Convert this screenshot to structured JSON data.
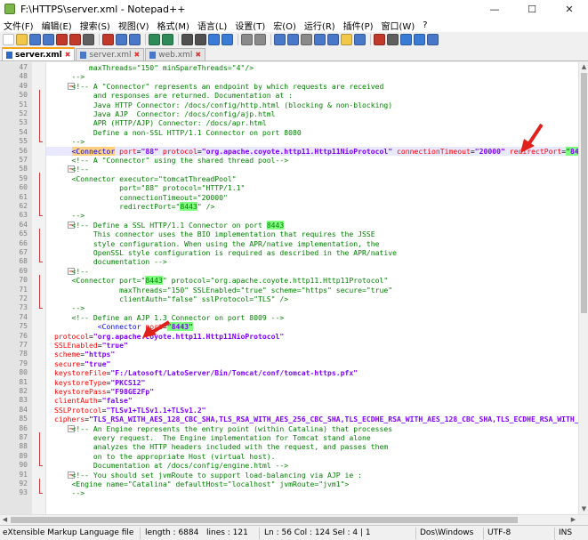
{
  "window": {
    "title": "F:\\HTTPS\\server.xml - Notepad++",
    "minimize": "—",
    "maximize": "☐",
    "close": "✕"
  },
  "menu": [
    "文件(F)",
    "编辑(E)",
    "搜索(S)",
    "视图(V)",
    "格式(M)",
    "语言(L)",
    "设置(T)",
    "宏(O)",
    "运行(R)",
    "插件(P)",
    "窗口(W)",
    "?"
  ],
  "toolbar_icons": [
    "new-file-icon",
    "open-file-icon",
    "save-icon",
    "save-all-icon",
    "close-icon",
    "close-all-icon",
    "print-icon",
    "cut-icon",
    "copy-icon",
    "paste-icon",
    "undo-icon",
    "redo-icon",
    "find-icon",
    "replace-icon",
    "zoom-in-icon",
    "zoom-out-icon",
    "sync-v-icon",
    "sync-h-icon",
    "word-wrap-icon",
    "show-all-icon",
    "indent-guide-icon",
    "doc-map-icon",
    "function-list-icon",
    "folder-icon",
    "monitor-icon",
    "record-macro-icon",
    "stop-macro-icon",
    "play-macro-icon",
    "run-macro-icon",
    "save-macro-icon"
  ],
  "tabs": [
    {
      "label": "server.xml",
      "active": true
    },
    {
      "label": "server.xml",
      "active": false
    },
    {
      "label": "web.xml",
      "active": false
    }
  ],
  "lines": [
    {
      "n": "47",
      "t": "        maxThreads=\"150\" minSpareThreads=\"4\"/>",
      "k": "com"
    },
    {
      "n": "48",
      "t": "    -->",
      "k": "com"
    },
    {
      "n": "49",
      "t": "    <!-- A \"Connector\" represents an endpoint by which requests are received",
      "k": "com",
      "fold": "start"
    },
    {
      "n": "50",
      "t": "         and responses are returned. Documentation at :",
      "k": "com"
    },
    {
      "n": "51",
      "t": "         Java HTTP Connector: /docs/config/http.html (blocking & non-blocking)",
      "k": "com"
    },
    {
      "n": "52",
      "t": "         Java AJP  Connector: /docs/config/ajp.html",
      "k": "com"
    },
    {
      "n": "53",
      "t": "         APR (HTTP/AJP) Connector: /docs/apr.html",
      "k": "com"
    },
    {
      "n": "54",
      "t": "         Define a non-SSL HTTP/1.1 Connector on port 8080",
      "k": "com"
    },
    {
      "n": "55",
      "t": "    -->",
      "k": "com",
      "fold": "end"
    },
    {
      "n": "56",
      "t": "",
      "k": "l56"
    },
    {
      "n": "57",
      "t": "    <!-- A \"Connector\" using the shared thread pool-->",
      "k": "com"
    },
    {
      "n": "58",
      "t": "    <!--",
      "k": "com",
      "fold": "start"
    },
    {
      "n": "59",
      "t": "    <Connector executor=\"tomcatThreadPool\"",
      "k": "com"
    },
    {
      "n": "60",
      "t": "               port=\"88\" protocol=\"HTTP/1.1\"",
      "k": "com"
    },
    {
      "n": "61",
      "t": "               connectionTimeout=\"20000\"",
      "k": "com"
    },
    {
      "n": "62",
      "t": "               redirectPort=\"8443\" />",
      "k": "com",
      "hlw": "8443"
    },
    {
      "n": "63",
      "t": "    -->",
      "k": "com",
      "fold": "end"
    },
    {
      "n": "64",
      "t": "    <!-- Define a SSL HTTP/1.1 Connector on port 8443",
      "k": "com",
      "fold": "start",
      "hlw": "8443"
    },
    {
      "n": "65",
      "t": "         This connector uses the BIO implementation that requires the JSSE",
      "k": "com"
    },
    {
      "n": "66",
      "t": "         style configuration. When using the APR/native implementation, the",
      "k": "com"
    },
    {
      "n": "67",
      "t": "         OpenSSL style configuration is required as described in the APR/native",
      "k": "com"
    },
    {
      "n": "68",
      "t": "         documentation -->",
      "k": "com",
      "fold": "end"
    },
    {
      "n": "69",
      "t": "    <!--",
      "k": "com",
      "fold": "start"
    },
    {
      "n": "70",
      "t": "    <Connector port=\"8443\" protocol=\"org.apache.coyote.http11.Http11Protocol\"",
      "k": "com",
      "hlw": "8443"
    },
    {
      "n": "71",
      "t": "               maxThreads=\"150\" SSLEnabled=\"true\" scheme=\"https\" secure=\"true\"",
      "k": "com"
    },
    {
      "n": "72",
      "t": "               clientAuth=\"false\" sslProtocol=\"TLS\" />",
      "k": "com"
    },
    {
      "n": "73",
      "t": "    -->",
      "k": "com",
      "fold": "end"
    },
    {
      "n": "74",
      "t": "    <!-- Define an AJP 1.3 Connector on port 8009 -->",
      "k": "com"
    },
    {
      "n": "75",
      "t": "",
      "k": "l75"
    },
    {
      "n": "76",
      "t": "",
      "k": "attrline",
      "a": "protocol",
      "v": "\"org.apache.coyote.http11.Http11NioProtocol\""
    },
    {
      "n": "77",
      "t": "",
      "k": "attrline",
      "a": "SSLEnabled",
      "v": "\"true\""
    },
    {
      "n": "78",
      "t": "",
      "k": "attrline",
      "a": "scheme",
      "v": "\"https\""
    },
    {
      "n": "79",
      "t": "",
      "k": "attrline",
      "a": "secure",
      "v": "\"true\""
    },
    {
      "n": "80",
      "t": "",
      "k": "attrline",
      "a": "keystoreFile",
      "v": "\"F:/Latosoft/LatoServer/Bin/Tomcat/conf/tomcat-https.pfx\""
    },
    {
      "n": "81",
      "t": "",
      "k": "attrline",
      "a": "keystoreType",
      "v": "\"PKCS12\""
    },
    {
      "n": "82",
      "t": "",
      "k": "attrline",
      "a": "keystorePass",
      "v": "\"F98GE2Fp\""
    },
    {
      "n": "83",
      "t": "",
      "k": "attrline",
      "a": "clientAuth",
      "v": "\"false\""
    },
    {
      "n": "84",
      "t": "",
      "k": "attrline",
      "a": "SSLProtocol",
      "v": "\"TLSv1+TLSv1.1+TLSv1.2\""
    },
    {
      "n": "85",
      "t": "",
      "k": "attrline",
      "a": "ciphers",
      "v": "\"TLS_RSA_WITH_AES_128_CBC_SHA,TLS_RSA_WITH_AES_256_CBC_SHA,TLS_ECDHE_RSA_WITH_AES_128_CBC_SHA,TLS_ECDHE_RSA_WITH_AES"
    },
    {
      "n": "86",
      "t": "    <!-- An Engine represents the entry point (within Catalina) that processes",
      "k": "com",
      "fold": "start"
    },
    {
      "n": "87",
      "t": "         every request.  The Engine implementation for Tomcat stand alone",
      "k": "com"
    },
    {
      "n": "88",
      "t": "         analyzes the HTTP headers included with the request, and passes them",
      "k": "com"
    },
    {
      "n": "89",
      "t": "         on to the appropriate Host (virtual host).",
      "k": "com"
    },
    {
      "n": "90",
      "t": "         Documentation at /docs/config/engine.html -->",
      "k": "com",
      "fold": "end"
    },
    {
      "n": "91",
      "t": "    <!-- You should set jvmRoute to support load-balancing via AJP ie :",
      "k": "com",
      "fold": "start"
    },
    {
      "n": "92",
      "t": "    <Engine name=\"Catalina\" defaultHost=\"localhost\" jvmRoute=\"jvm1\">",
      "k": "com"
    },
    {
      "n": "93",
      "t": "    -->",
      "k": "com",
      "fold": "end"
    }
  ],
  "line56": {
    "open": "<Connector",
    "a1": "port",
    "v1": "\"88\"",
    "a2": "protocol",
    "v2": "\"org.apache.coyote.http11.Http11NioProtocol\"",
    "a3": "connectionTimeout",
    "v3": "\"20000\"",
    "a4": "redirectPort",
    "v4": "\"8443\"",
    "close": "/>"
  },
  "line75": {
    "open": "<Connector",
    "a1": "port",
    "v1": "\"8443\""
  },
  "status": {
    "lang": "eXtensible Markup Language file",
    "length": "length : 6884",
    "lines": "lines : 121",
    "pos": "Ln : 56   Col : 124   Sel : 4 | 1",
    "eol": "Dos\\Windows",
    "enc": "UTF-8",
    "ins": "INS"
  },
  "accent": "#f7a21b"
}
